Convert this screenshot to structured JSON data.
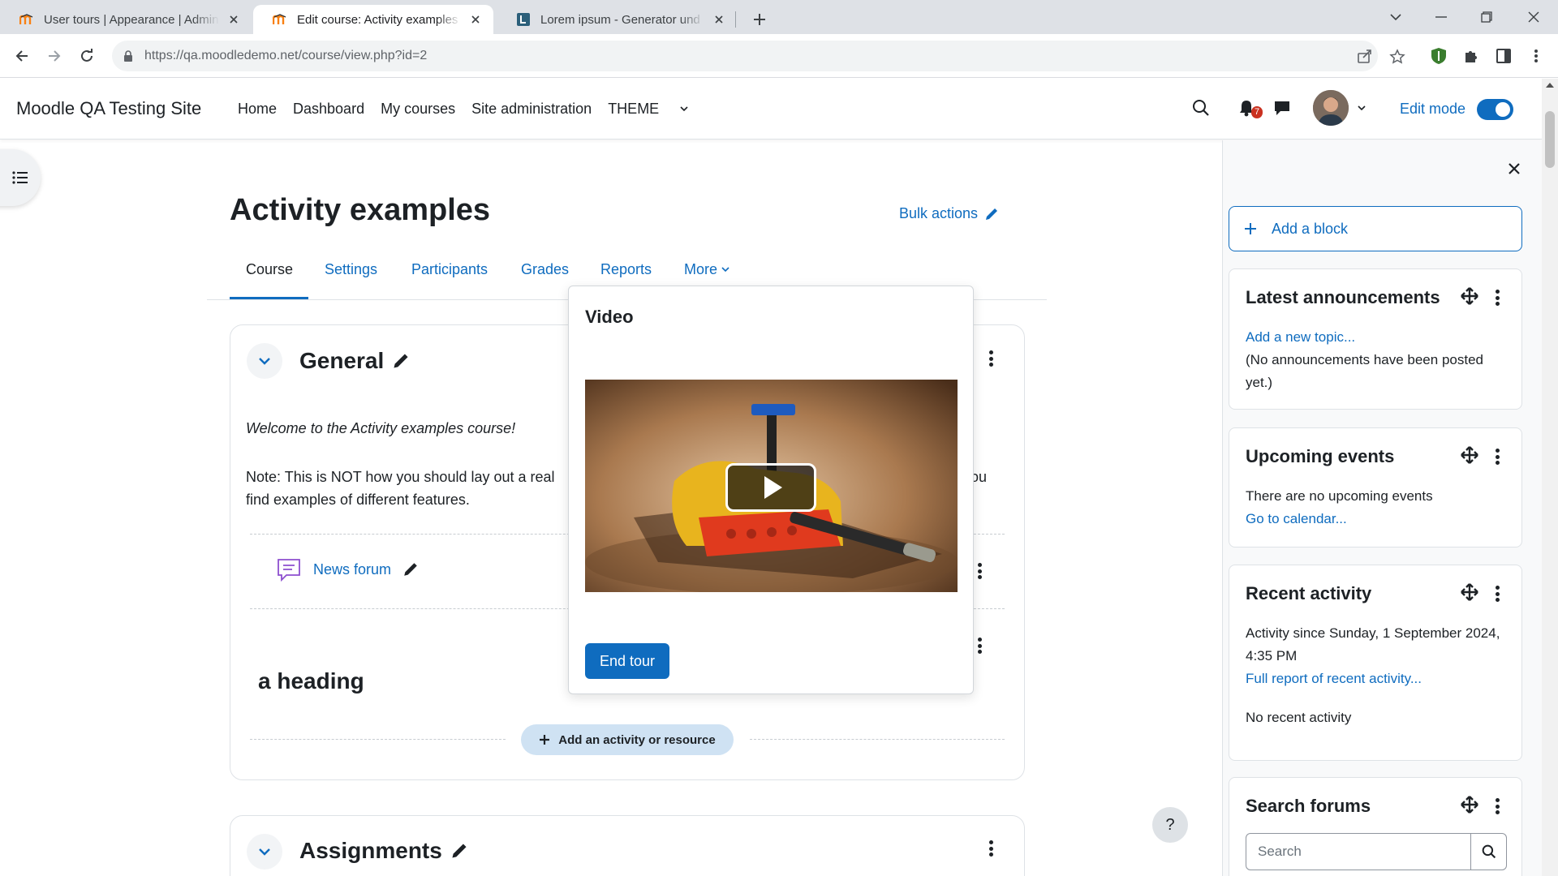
{
  "browser": {
    "tabs": [
      {
        "title": "User tours | Appearance | Admini"
      },
      {
        "title": "Edit course: Activity examples | M"
      },
      {
        "title": "Lorem ipsum - Generator und Inf"
      }
    ],
    "url": "https://qa.moodledemo.net/course/view.php?id=2"
  },
  "nav": {
    "site_name": "Moodle QA Testing Site",
    "items": [
      "Home",
      "Dashboard",
      "My courses",
      "Site administration",
      "THEME"
    ],
    "notification_count": "7",
    "edit_mode_label": "Edit mode"
  },
  "course": {
    "title": "Activity examples",
    "bulk_actions": "Bulk actions",
    "tabs": [
      "Course",
      "Settings",
      "Participants",
      "Grades",
      "Reports",
      "More"
    ],
    "sections": [
      {
        "title": "General"
      },
      {
        "title": "Assignments"
      }
    ],
    "welcome": "Welcome to the Activity examples course!",
    "note_start": "Note: This is NOT how you should lay out a real",
    "note_end": "find examples of different features.",
    "note_tail": "ou",
    "news_forum": "News forum",
    "heading": "a heading",
    "add_activity": "Add an activity or resource"
  },
  "tour": {
    "title": "Video",
    "end_button": "End tour"
  },
  "help": "?",
  "drawer": {
    "add_block": "Add a block",
    "blocks": {
      "announcements": {
        "title": "Latest announcements",
        "link": "Add a new topic...",
        "text": "(No announcements have been posted yet.)"
      },
      "events": {
        "title": "Upcoming events",
        "text": "There are no upcoming events",
        "link": "Go to calendar..."
      },
      "recent": {
        "title": "Recent activity",
        "since": "Activity since Sunday, 1 September 2024, 4:35 PM",
        "link": "Full report of recent activity...",
        "none": "No recent activity"
      },
      "search": {
        "title": "Search forums",
        "placeholder": "Search"
      }
    }
  },
  "colors": {
    "primary": "#0f6cbf",
    "badge": "#ca3120"
  }
}
